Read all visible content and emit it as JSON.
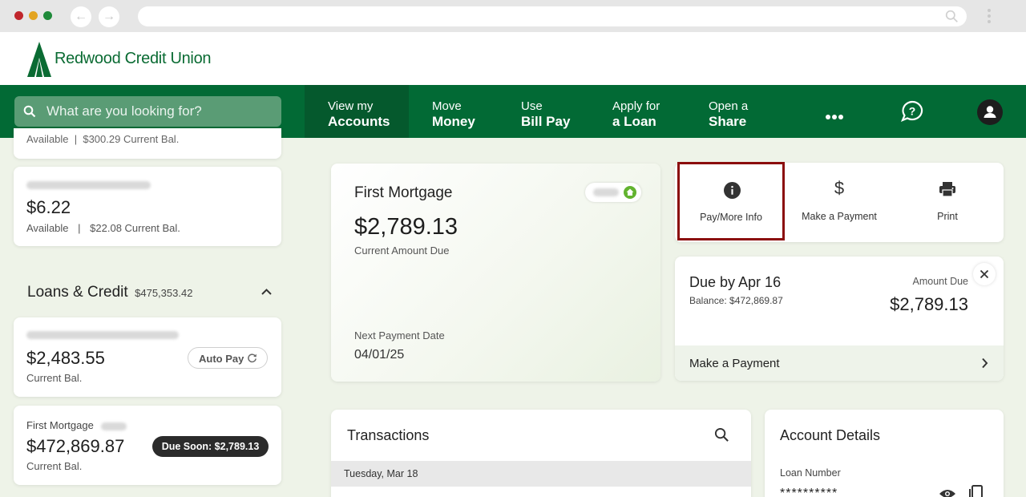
{
  "browser": {
    "window_colors": {
      "close": "#c0262c",
      "minimize": "#e3a421",
      "maximize": "#1f8a3a"
    },
    "back_glyph": "←",
    "forward_glyph": "→"
  },
  "site": {
    "logo_text": "Redwood Credit Union",
    "brand_color": "#026a35"
  },
  "nav": {
    "search_placeholder": "What are you looking for?",
    "items": [
      {
        "line1": "View my",
        "line2": "Accounts"
      },
      {
        "line1": "Move",
        "line2": "Money"
      },
      {
        "line1": "Use",
        "line2": "Bill Pay"
      },
      {
        "line1": "Apply for",
        "line2": "a Loan"
      },
      {
        "line1": "Open a",
        "line2": "Share"
      }
    ]
  },
  "sidebar": {
    "top_partial_text": "Available  |  $300.29 Current Bal.",
    "account1": {
      "amount": "$6.22",
      "available": "Available",
      "separator": "|",
      "current": "$22.08 Current Bal."
    },
    "loans_section": {
      "title": "Loans & Credit",
      "total": "$475,353.42"
    },
    "loan1": {
      "amount": "$2,483.55",
      "sub": "Current Bal.",
      "autopay": "Auto Pay"
    },
    "loan2": {
      "name": "First Mortgage",
      "amount": "$472,869.87",
      "sub": "Current Bal.",
      "badge": "Due Soon: $2,789.13"
    }
  },
  "mortgage_card": {
    "title": "First Mortgage",
    "amount": "$2,789.13",
    "amount_label": "Current Amount Due",
    "next_label": "Next Payment Date",
    "next_date": "04/01/25"
  },
  "actions": {
    "items": [
      {
        "label": "Pay/More Info",
        "icon": "info-icon"
      },
      {
        "label": "Make a Payment",
        "icon": "dollar-icon"
      },
      {
        "label": "Print",
        "icon": "printer-icon"
      }
    ],
    "highlight_color": "#8b0d0d"
  },
  "due_card": {
    "title": "Due by Apr 16",
    "balance": "Balance: $472,869.87",
    "amount_label": "Amount Due",
    "amount": "$2,789.13",
    "link": "Make a Payment"
  },
  "transactions": {
    "title": "Transactions",
    "date_header": "Tuesday, Mar 18"
  },
  "account_details": {
    "title": "Account Details",
    "loan_number_label": "Loan Number",
    "loan_number_value": "**********"
  }
}
